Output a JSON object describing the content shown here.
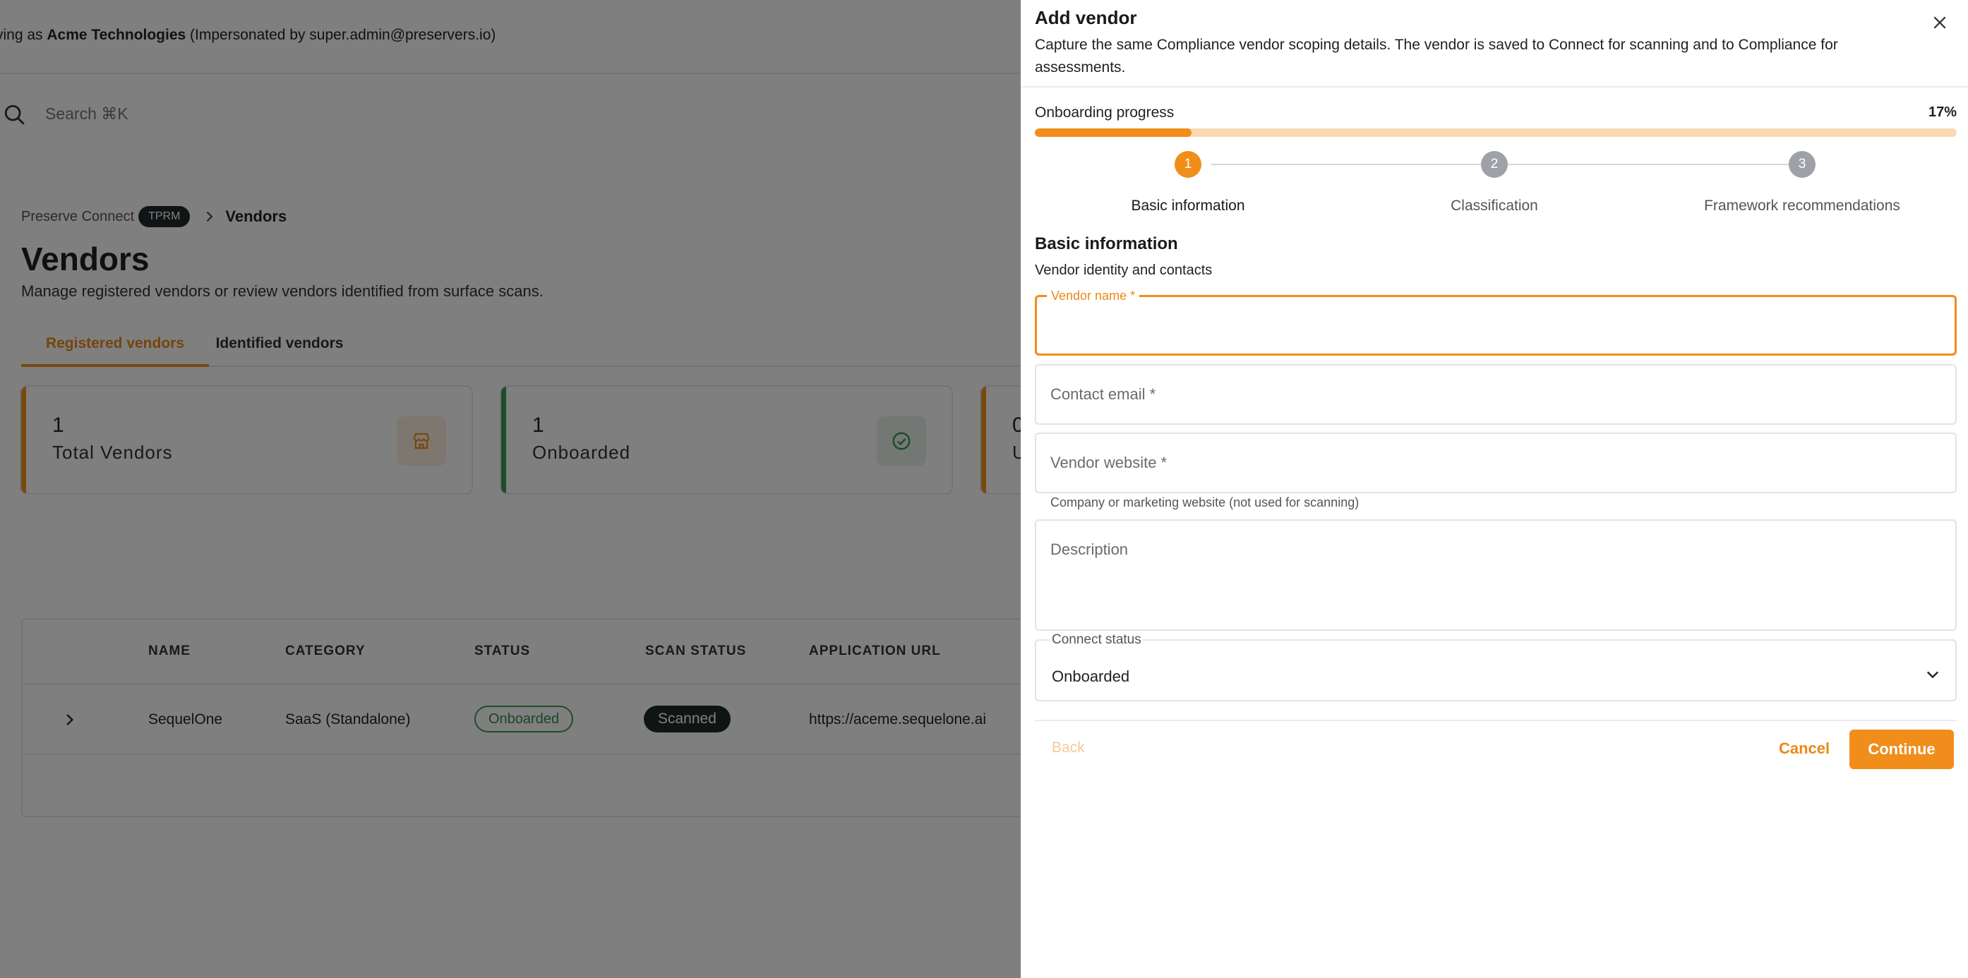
{
  "banner": {
    "prefix": "ving as ",
    "org": "Acme Technologies",
    "suffix": " (Impersonated by super.admin@preservers.io)"
  },
  "search": {
    "placeholder": "Search ⌘K"
  },
  "breadcrumb": {
    "root": "Preserve Connect",
    "badge": "TPRM",
    "current": "Vendors"
  },
  "page": {
    "title": "Vendors",
    "subtitle": "Manage registered vendors or review vendors identified from surface scans."
  },
  "tabs": {
    "registered": "Registered vendors",
    "identified": "Identified vendors"
  },
  "stats": [
    {
      "value": "1",
      "label": "Total Vendors",
      "icon": "store-icon",
      "accent": "#f0921e"
    },
    {
      "value": "1",
      "label": "Onboarded",
      "icon": "check-circle-icon",
      "accent": "#3a9a52"
    },
    {
      "value": "0",
      "label": "U",
      "accent": "#f0921e"
    }
  ],
  "table": {
    "headers": {
      "name": "NAME",
      "category": "CATEGORY",
      "status": "STATUS",
      "scan_status": "SCAN STATUS",
      "app_url": "APPLICATION URL"
    },
    "rows": [
      {
        "name": "SequelOne",
        "category": "SaaS (Standalone)",
        "status": "Onboarded",
        "scan_status": "Scanned",
        "app_url": "https://aceme.sequelone.ai"
      }
    ]
  },
  "drawer": {
    "title": "Add vendor",
    "description": "Capture the same Compliance vendor scoping details. The vendor is saved to Connect for scanning and to Compliance for assessments.",
    "progress": {
      "label": "Onboarding progress",
      "percent_text": "17%",
      "value": 0.17
    },
    "steps": [
      {
        "number": "1",
        "label": "Basic information",
        "state": "active"
      },
      {
        "number": "2",
        "label": "Classification",
        "state": "inactive"
      },
      {
        "number": "3",
        "label": "Framework recommendations",
        "state": "inactive"
      }
    ],
    "section": {
      "title": "Basic information",
      "subtitle": "Vendor identity and contacts"
    },
    "fields": {
      "vendor_name": {
        "label": "Vendor name *",
        "value": ""
      },
      "contact_email": {
        "placeholder": "Contact email *",
        "value": ""
      },
      "vendor_website": {
        "placeholder": "Vendor website *",
        "value": "",
        "helper": "Company or marketing website (not used for scanning)"
      },
      "description": {
        "placeholder": "Description",
        "value": ""
      },
      "connect_status": {
        "label": "Connect status",
        "value": "Onboarded"
      }
    },
    "buttons": {
      "back": "Back",
      "cancel": "Cancel",
      "continue": "Continue"
    }
  },
  "colors": {
    "accent": "#f18d1a",
    "success": "#3a9a52",
    "dark": "#1f2a2a"
  }
}
